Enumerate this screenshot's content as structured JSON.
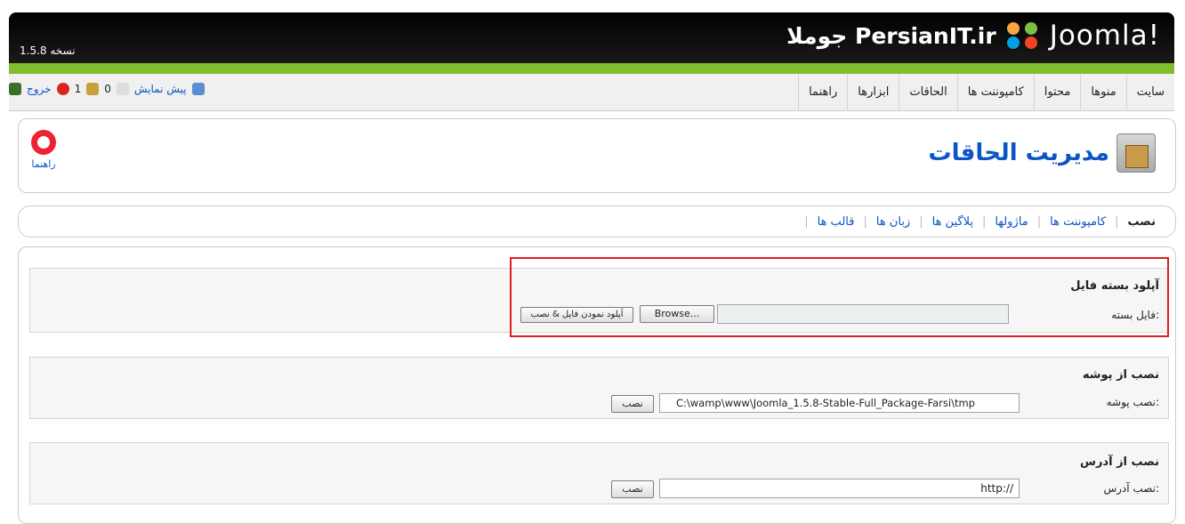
{
  "header": {
    "brand_name": "Joomla!",
    "site_name": "PersianIT.ir جوملا",
    "version": "نسخه 1.5.8"
  },
  "menu": {
    "items": [
      "سایت",
      "منوها",
      "محتوا",
      "کامپوننت ها",
      "الحاقات",
      "ابزارها",
      "راهنما"
    ]
  },
  "status": {
    "logout": "خروج",
    "users_count": "1",
    "messages_count": "0",
    "preview": "پیش نمایش"
  },
  "toolbar": {
    "title": "مدیریت الحاقات",
    "help_label": "راهنما"
  },
  "submenu": {
    "items": [
      "نصب",
      "کامپوننت ها",
      "ماژولها",
      "پلاگین ها",
      "زبان ها",
      "قالب ها"
    ]
  },
  "upload": {
    "title": "آپلود بسته فایل",
    "label": "فایل بسته:",
    "browse_label": "Browse...",
    "submit_label": "آپلود نمودن فایل & نصب"
  },
  "directory": {
    "title": "نصب از پوشه",
    "label": "نصب پوشه:",
    "value": "C:\\wamp\\www\\Joomla_1.5.8-Stable-Full_Package-Farsi\\tmp",
    "button_label": "نصب"
  },
  "url": {
    "title": "نصب از آدرس",
    "label": "نصب آدرس:",
    "value": "http://",
    "button_label": "نصب"
  }
}
